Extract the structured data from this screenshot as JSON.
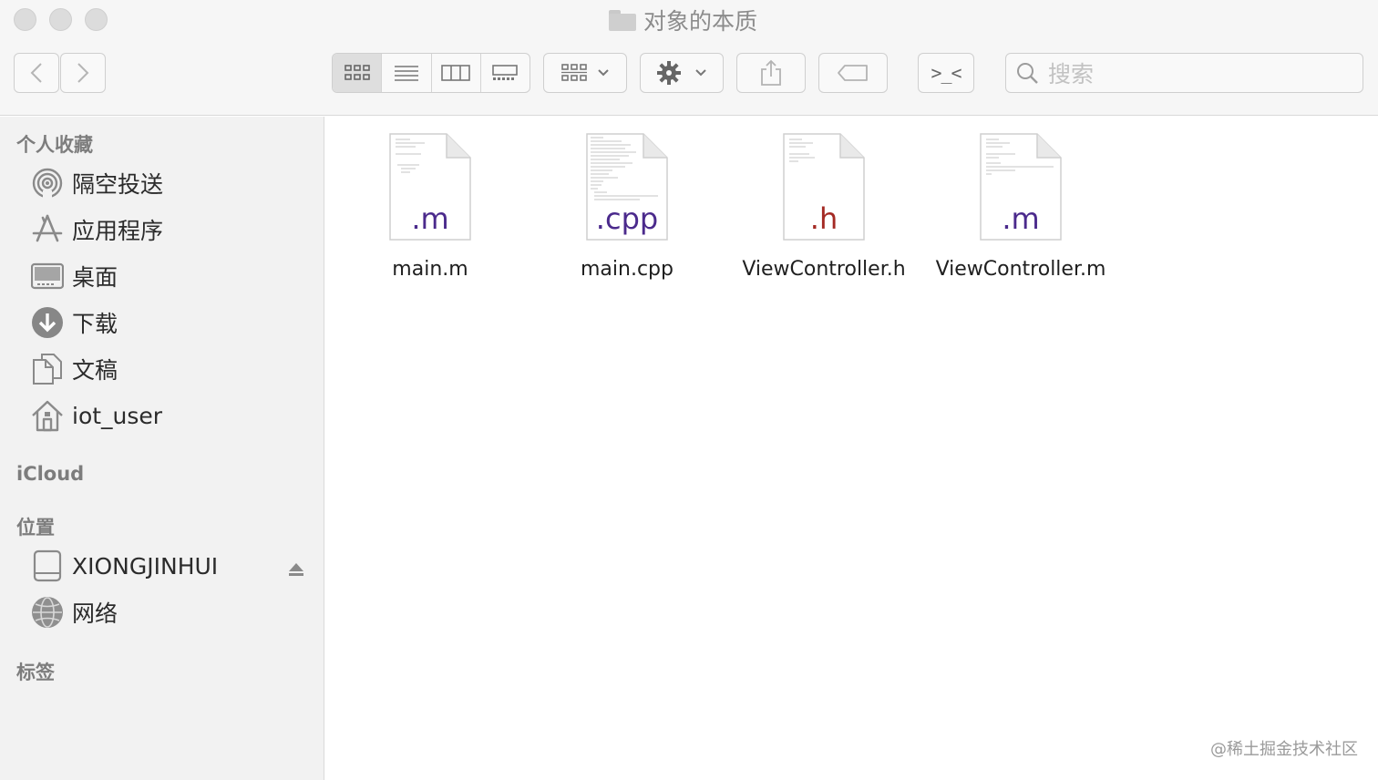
{
  "window": {
    "title": "对象的本质"
  },
  "toolbar": {
    "search_placeholder": "搜索",
    "terminal_label": ">_<"
  },
  "sidebar": {
    "favorites_header": "个人收藏",
    "favorites": [
      {
        "label": "隔空投送",
        "icon": "airdrop-icon"
      },
      {
        "label": "应用程序",
        "icon": "applications-icon"
      },
      {
        "label": "桌面",
        "icon": "desktop-icon"
      },
      {
        "label": "下载",
        "icon": "downloads-icon"
      },
      {
        "label": "文稿",
        "icon": "documents-icon"
      },
      {
        "label": "iot_user",
        "icon": "home-icon"
      }
    ],
    "icloud_header": "iCloud",
    "locations_header": "位置",
    "locations": [
      {
        "label": "XIONGJINHUI",
        "icon": "disk-icon"
      },
      {
        "label": "网络",
        "icon": "network-icon"
      }
    ],
    "tags_header": "标签"
  },
  "files": [
    {
      "name": "main.m",
      "ext": ".m",
      "ext_color": "#4b2a8c"
    },
    {
      "name": "main.cpp",
      "ext": ".cpp",
      "ext_color": "#4b2a8c"
    },
    {
      "name": "ViewController.h",
      "ext": ".h",
      "ext_color": "#a42a24"
    },
    {
      "name": "ViewController.m",
      "ext": ".m",
      "ext_color": "#4b2a8c"
    }
  ],
  "watermark": "@稀土掘金技术社区"
}
